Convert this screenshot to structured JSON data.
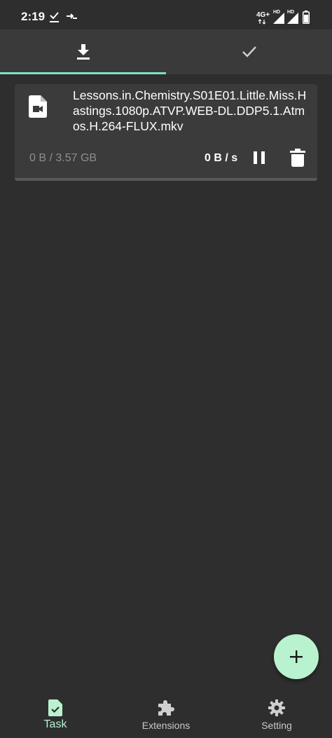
{
  "status_bar": {
    "time": "2:19",
    "network": "4G+",
    "hd_1": "HD",
    "hd_2": "HD"
  },
  "tabs": [
    {
      "name": "downloading",
      "icon": "download-icon",
      "active": true
    },
    {
      "name": "completed",
      "icon": "check-icon",
      "active": false
    }
  ],
  "task": {
    "file_icon": "video-file-icon",
    "file_name": "Lessons.in.Chemistry.S01E01.Little.Miss.Hastings.1080p.ATVP.WEB-DL.DDP5.1.Atmos.H.264-FLUX.mkv",
    "size": "0 B / 3.57 GB",
    "speed": "0 B / s",
    "progress": 0
  },
  "fab": {
    "icon": "plus-icon"
  },
  "bottom_nav": [
    {
      "label": "Task",
      "icon": "task-icon",
      "active": true
    },
    {
      "label": "Extensions",
      "icon": "puzzle-icon",
      "active": false
    },
    {
      "label": "Setting",
      "icon": "gear-icon",
      "active": false
    }
  ],
  "colors": {
    "background": "#2e2e2e",
    "accent": "#7fe0c8",
    "fab": "#b9f2cf",
    "card": "#3b3b3b"
  }
}
